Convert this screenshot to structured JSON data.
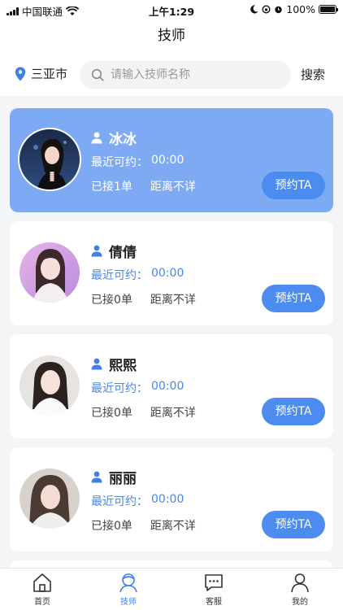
{
  "status_bar": {
    "carrier": "中国联通",
    "time": "上午1:29",
    "battery": "100%"
  },
  "header": {
    "title": "技师"
  },
  "search": {
    "city": "三亚市",
    "placeholder": "请输入技师名称",
    "button_label": "搜索"
  },
  "technicians": [
    {
      "name": "冰冰",
      "avail_label": "最近可约：",
      "avail_time": "00:00",
      "orders": "已接1单",
      "distance": "距离不详",
      "book_label": "预约TA",
      "highlighted": true
    },
    {
      "name": "倩倩",
      "avail_label": "最近可约：",
      "avail_time": "00:00",
      "orders": "已接0单",
      "distance": "距离不详",
      "book_label": "预约TA",
      "highlighted": false
    },
    {
      "name": "熙熙",
      "avail_label": "最近可约：",
      "avail_time": "00:00",
      "orders": "已接0单",
      "distance": "距离不详",
      "book_label": "预约TA",
      "highlighted": false
    },
    {
      "name": "丽丽",
      "avail_label": "最近可约：",
      "avail_time": "00:00",
      "orders": "已接0单",
      "distance": "距离不详",
      "book_label": "预约TA",
      "highlighted": false
    }
  ],
  "tabbar": {
    "items": [
      {
        "label": "首页",
        "icon": "home-icon"
      },
      {
        "label": "技师",
        "icon": "technician-icon",
        "active": true
      },
      {
        "label": "客服",
        "icon": "chat-icon"
      },
      {
        "label": "我的",
        "icon": "profile-icon"
      }
    ]
  },
  "colors": {
    "accent": "#4c8cf0",
    "active_card": "#7eaaf4",
    "active_tab": "#3f7fe8"
  }
}
